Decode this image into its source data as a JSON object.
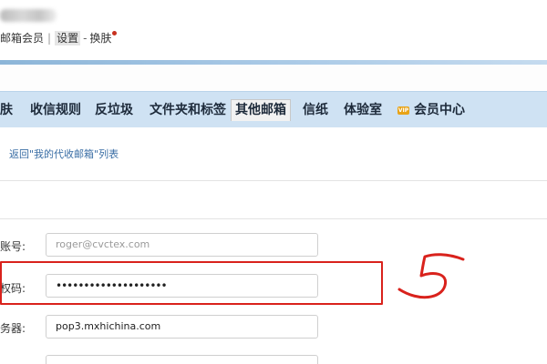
{
  "header": {
    "links": {
      "mailbox_member": "邮箱会员",
      "separator": "|",
      "settings": "设置",
      "dash": "-",
      "skin": "换肤"
    },
    "notification_color": "#c7311f"
  },
  "tabs": [
    {
      "label": "肤"
    },
    {
      "label": "收信规则"
    },
    {
      "label": "反垃圾"
    },
    {
      "label": "文件夹和标签"
    },
    {
      "label": "其他邮箱",
      "active": true
    },
    {
      "label": "信纸"
    },
    {
      "label": "体验室"
    },
    {
      "label": "会员中心",
      "icon": "vip-icon"
    }
  ],
  "back_link": "返回\"我的代收邮箱\"列表",
  "form": {
    "account": {
      "label": "账号:",
      "value": "roger@cvctex.com"
    },
    "auth_code": {
      "label": "权码:",
      "value": "••••••••••••••••••••"
    },
    "server": {
      "label": "务器:",
      "value": "pop3.mxhichina.com"
    }
  },
  "colors": {
    "tab_bar": "#cfe2f3",
    "highlight": "#d9221c",
    "link": "#3a6ea5"
  }
}
